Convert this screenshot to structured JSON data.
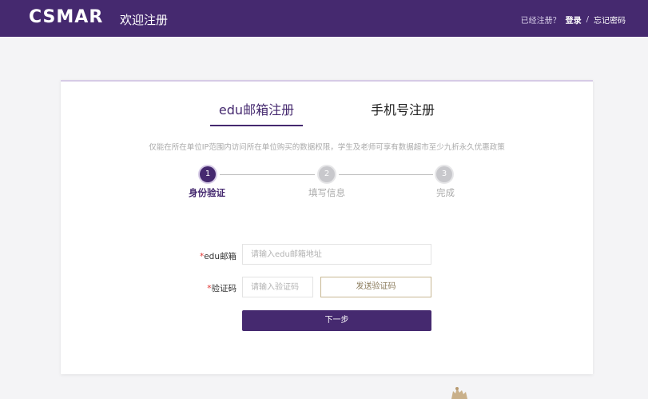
{
  "header": {
    "logo": "CSMAR",
    "title": "欢迎注册",
    "already_registered": "已经注册？",
    "login_label": "登录",
    "separator": "/",
    "forgot_password_label": "忘记密码"
  },
  "tabs": [
    {
      "label": "edu邮箱注册",
      "active": true
    },
    {
      "label": "手机号注册",
      "active": false
    }
  ],
  "notice": "仅能在所在单位IP范围内访问所在单位购买的数据权限，学生及老师可享有数据超市至少九折永久优惠政策",
  "steps": [
    {
      "number": "1",
      "label": "身份验证",
      "active": true
    },
    {
      "number": "2",
      "label": "填写信息",
      "active": false
    },
    {
      "number": "3",
      "label": "完成",
      "active": false
    }
  ],
  "form": {
    "required_mark": "*",
    "email_label": "edu邮箱",
    "email_placeholder": "请输入edu邮箱地址",
    "email_value": "",
    "code_label": "验证码",
    "code_placeholder": "请输入验证码",
    "code_value": "",
    "send_code_label": "发送验证码",
    "next_label": "下一步"
  },
  "colors": {
    "brand": "#45296f",
    "required": "#e0312f",
    "send_border": "#c8b894"
  }
}
